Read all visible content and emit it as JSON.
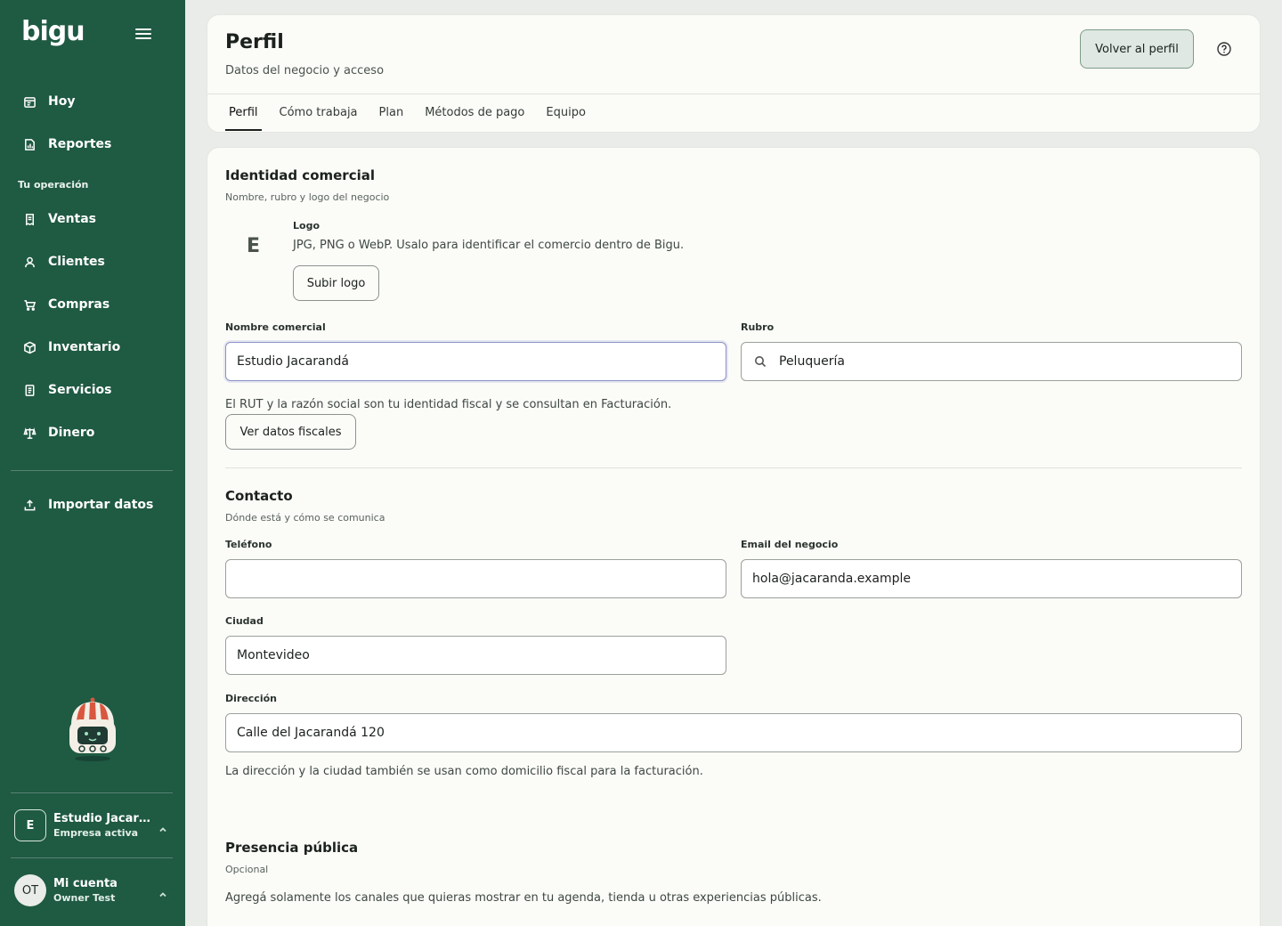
{
  "app": {
    "brand": "bigu"
  },
  "sidebar": {
    "top_items": [
      {
        "label": "Hoy",
        "icon": "calendar-icon"
      },
      {
        "label": "Reportes",
        "icon": "report-icon"
      }
    ],
    "section_label": "Tu operación",
    "items": [
      {
        "label": "Ventas",
        "icon": "receipt-icon"
      },
      {
        "label": "Clientes",
        "icon": "user-icon"
      },
      {
        "label": "Compras",
        "icon": "cart-icon"
      },
      {
        "label": "Inventario",
        "icon": "box-icon"
      },
      {
        "label": "Servicios",
        "icon": "document-icon"
      },
      {
        "label": "Dinero",
        "icon": "scale-icon"
      }
    ],
    "import_label": "Importar datos",
    "company": {
      "avatar": "E",
      "name": "Estudio Jacaranda",
      "status": "Empresa activa"
    },
    "account": {
      "avatar": "OT",
      "title": "Mi cuenta",
      "user": "Owner Test"
    }
  },
  "header": {
    "title": "Perfil",
    "subtitle": "Datos del negocio y acceso",
    "back_button": "Volver al perfil",
    "tabs": [
      {
        "label": "Perfil",
        "active": true
      },
      {
        "label": "Cómo trabaja",
        "active": false
      },
      {
        "label": "Plan",
        "active": false
      },
      {
        "label": "Métodos de pago",
        "active": false
      },
      {
        "label": "Equipo",
        "active": false
      }
    ]
  },
  "identity": {
    "title": "Identidad comercial",
    "subtitle": "Nombre, rubro y logo del negocio",
    "logo_letter": "E",
    "logo_label": "Logo",
    "logo_help": "JPG, PNG o WebP. Usalo para identificar el comercio dentro de Bigu.",
    "upload_button": "Subir logo",
    "name_label": "Nombre comercial",
    "name_value": "Estudio Jacarandá",
    "category_label": "Rubro",
    "category_value": "Peluquería",
    "fiscal_help": "El RUT y la razón social son tu identidad fiscal y se consultan en Facturación.",
    "fiscal_button": "Ver datos fiscales"
  },
  "contact": {
    "title": "Contacto",
    "subtitle": "Dónde está y cómo se comunica",
    "phone_label": "Teléfono",
    "phone_value": "",
    "email_label": "Email del negocio",
    "email_value": "hola@jacaranda.example",
    "city_label": "Ciudad",
    "city_value": "Montevideo",
    "address_label": "Dirección",
    "address_value": "Calle del Jacarandá 120",
    "address_help": "La dirección y la ciudad también se usan como domicilio fiscal para la facturación."
  },
  "public": {
    "title": "Presencia pública",
    "subtitle": "Opcional",
    "help": "Agregá solamente los canales que quieras mostrar en tu agenda, tienda u otras experiencias públicas."
  },
  "colors": {
    "sidebar_bg": "#1f5a43",
    "page_bg": "#e9ece8",
    "card_bg": "#fbfbf8",
    "focus_border": "#8a91c8"
  }
}
